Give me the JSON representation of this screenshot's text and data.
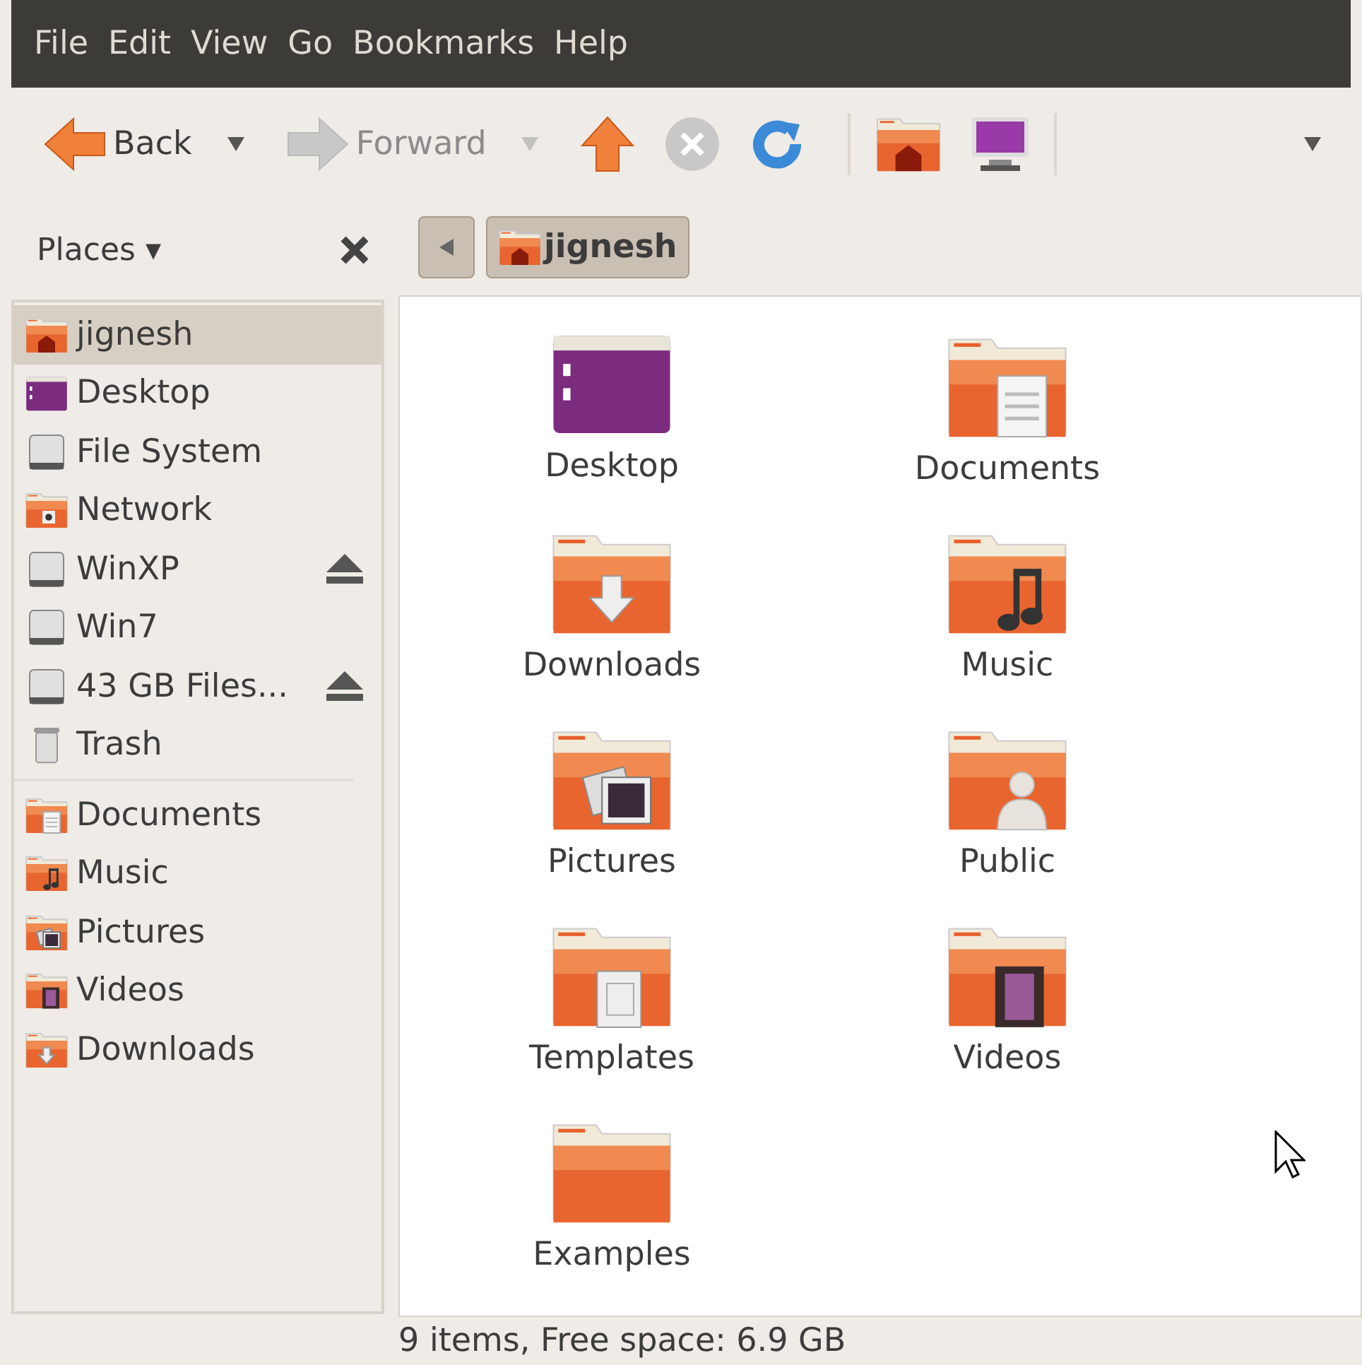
{
  "menu": [
    "File",
    "Edit",
    "View",
    "Go",
    "Bookmarks",
    "Help"
  ],
  "toolbar": [
    {
      "kind": "back",
      "label": "Back",
      "disabled": false,
      "dropdown": true
    },
    {
      "kind": "forward",
      "label": "Forward",
      "disabled": true,
      "dropdown": true
    },
    {
      "kind": "up",
      "disabled": false,
      "dropdown": false
    },
    {
      "kind": "stop",
      "disabled": true,
      "dropdown": false
    },
    {
      "kind": "reload",
      "disabled": false,
      "dropdown": false
    },
    {
      "kind": "home",
      "disabled": false,
      "dropdown": false
    },
    {
      "kind": "computer",
      "disabled": false,
      "dropdown": false
    }
  ],
  "sidebar": {
    "title": "Places ▾",
    "places": [
      {
        "kind": "home",
        "label": "jignesh",
        "selected": true,
        "ejectable": false
      },
      {
        "kind": "desktop",
        "label": "Desktop",
        "selected": false,
        "ejectable": false
      },
      {
        "kind": "drive",
        "label": "File System",
        "selected": false,
        "ejectable": false
      },
      {
        "kind": "network",
        "label": "Network",
        "selected": false,
        "ejectable": false
      },
      {
        "kind": "drive",
        "label": "WinXP",
        "selected": false,
        "ejectable": true
      },
      {
        "kind": "drive",
        "label": "Win7",
        "selected": false,
        "ejectable": false
      },
      {
        "kind": "drive",
        "label": "43 GB Files...",
        "selected": false,
        "ejectable": true
      },
      {
        "kind": "trash",
        "label": "Trash",
        "selected": false,
        "ejectable": false
      }
    ],
    "bookmarks": [
      {
        "kind": "documents",
        "label": "Documents",
        "selected": false,
        "ejectable": false
      },
      {
        "kind": "music",
        "label": "Music",
        "selected": false,
        "ejectable": false
      },
      {
        "kind": "pictures",
        "label": "Pictures",
        "selected": false,
        "ejectable": false
      },
      {
        "kind": "videos",
        "label": "Videos",
        "selected": false,
        "ejectable": false
      },
      {
        "kind": "downloads",
        "label": "Downloads",
        "selected": false,
        "ejectable": false
      }
    ]
  },
  "path": [
    {
      "kind": "home",
      "label": "jignesh",
      "selected": true
    }
  ],
  "files": [
    {
      "kind": "desktop",
      "label": "Desktop"
    },
    {
      "kind": "documents",
      "label": "Documents"
    },
    {
      "kind": "downloads",
      "label": "Downloads"
    },
    {
      "kind": "music",
      "label": "Music"
    },
    {
      "kind": "pictures",
      "label": "Pictures"
    },
    {
      "kind": "public",
      "label": "Public"
    },
    {
      "kind": "templates",
      "label": "Templates"
    },
    {
      "kind": "videos",
      "label": "Videos"
    },
    {
      "kind": "folder",
      "label": "Examples"
    }
  ],
  "status_bar": "9 items, Free space: 6.9 GB"
}
